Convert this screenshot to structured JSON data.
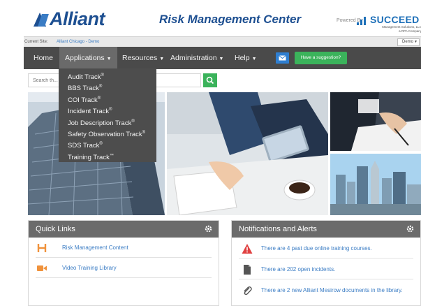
{
  "header": {
    "logo_text": "Alliant",
    "title": "Risk Management Center",
    "powered_by": "Powered By",
    "partner_name": "SUCCEED",
    "partner_sub": "Management Solutions, LLC a RPA Company"
  },
  "site": {
    "label": "Current Site:",
    "name": "Alliant Chicago - Demo",
    "selector_value": "Demo"
  },
  "nav": {
    "home": "Home",
    "applications": "Applications",
    "resources": "Resources",
    "administration": "Administration",
    "help": "Help",
    "suggestion_button": "Have a suggestion?"
  },
  "search": {
    "placeholder": "Search th..."
  },
  "applications_menu": [
    {
      "label": "Audit Track",
      "mark": "®"
    },
    {
      "label": "BBS Track",
      "mark": "®"
    },
    {
      "label": "COI Track",
      "mark": "®"
    },
    {
      "label": "Incident Track",
      "mark": "®"
    },
    {
      "label": "Job Description Track",
      "mark": "®"
    },
    {
      "label": "Safety Observation Track",
      "mark": "®"
    },
    {
      "label": "SDS Track",
      "mark": "®"
    },
    {
      "label": "Training Track",
      "mark": "™"
    }
  ],
  "quick_links": {
    "title": "Quick Links",
    "items": [
      {
        "label": "Risk Management Content",
        "icon": "h-letter-icon",
        "color": "#f0923b"
      },
      {
        "label": "Video Training Library",
        "icon": "video-camera-icon",
        "color": "#f0923b"
      }
    ]
  },
  "notifications": {
    "title": "Notifications and Alerts",
    "items": [
      {
        "label": "There are 4 past due online training courses.",
        "icon": "warning-icon",
        "color": "#e04040"
      },
      {
        "label": "There are 202 open incidents.",
        "icon": "document-icon",
        "color": "#555555"
      },
      {
        "label": "There are 2 new Alliant Mesirow documents in the library.",
        "icon": "paperclip-icon",
        "color": "#555555"
      }
    ]
  },
  "colors": {
    "brand_blue": "#1d4f91",
    "nav_bg": "#4a4a4a",
    "accent_green": "#3bb35b",
    "link_blue": "#3a7cc4"
  }
}
